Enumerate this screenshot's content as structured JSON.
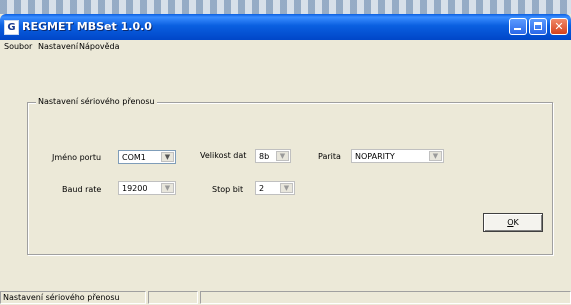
{
  "window": {
    "title": "REGMET MBSet 1.0.0",
    "icon_letter": "G"
  },
  "menu": {
    "items": [
      {
        "label": "Soubor"
      },
      {
        "label": "Nastavení"
      },
      {
        "label": "Nápověda"
      }
    ]
  },
  "group": {
    "title": "Nastavení sériového přenosu"
  },
  "fields": {
    "port": {
      "label": "Jméno portu",
      "value": "COM1"
    },
    "data_size": {
      "label": "Velikost dat",
      "value": "8b"
    },
    "parity": {
      "label": "Parita",
      "value": "NOPARITY"
    },
    "baud_rate": {
      "label": "Baud rate",
      "value": "19200"
    },
    "stop_bit": {
      "label": "Stop bit",
      "value": "2"
    }
  },
  "buttons": {
    "ok_underlined": "O",
    "ok_rest": "K"
  },
  "statusbar": {
    "panel1": "Nastavení sériového přenosu",
    "panel2": "",
    "panel3": ""
  },
  "colors": {
    "titlebar": "#0a5fe0",
    "window_bg": "#ece9d8",
    "close_button": "#d6421c"
  }
}
